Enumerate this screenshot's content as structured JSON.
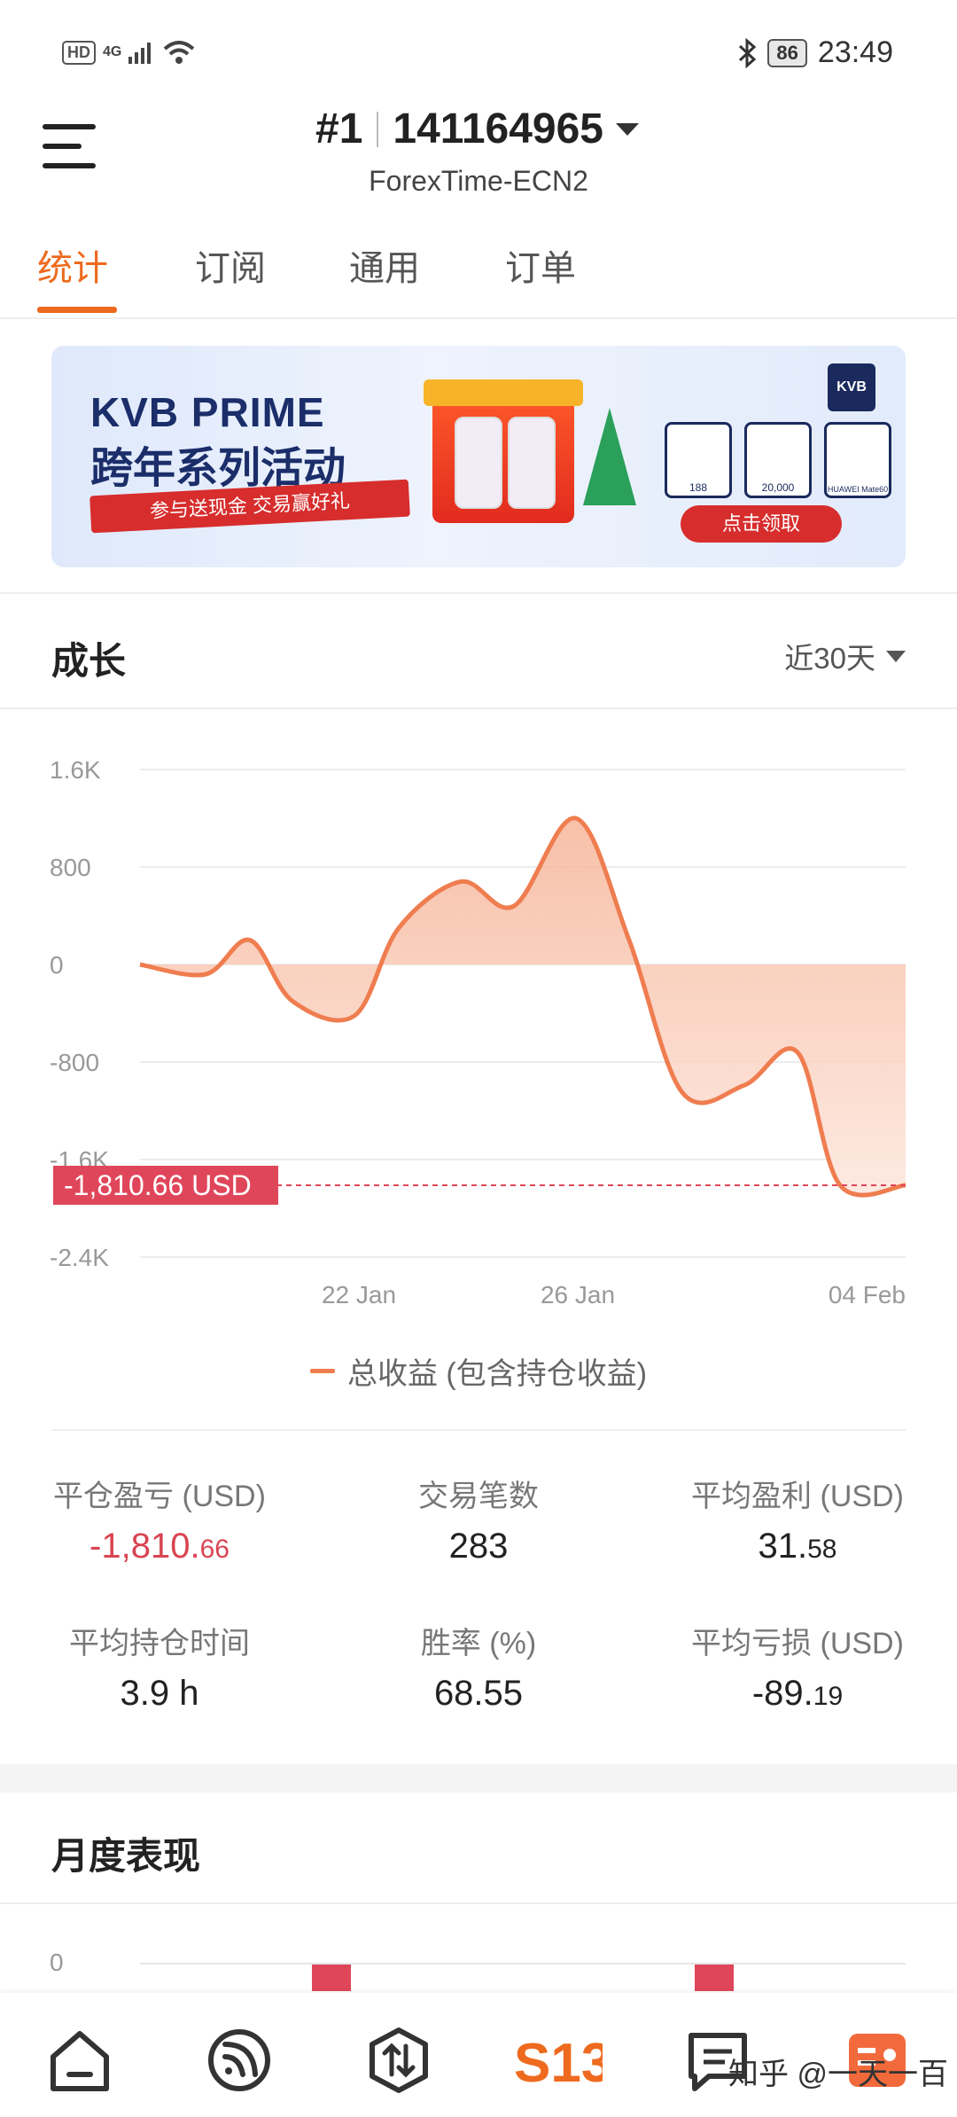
{
  "status_bar": {
    "hd": "HD",
    "network": "4G",
    "battery": "86",
    "time": "23:49"
  },
  "header": {
    "rank": "#1",
    "account": "141164965",
    "server": "ForexTime-ECN2"
  },
  "tabs": [
    "统计",
    "订阅",
    "通用",
    "订单"
  ],
  "banner": {
    "title": "KVB PRIME",
    "subtitle": "跨年系列活动",
    "ribbon": "参与送现金 交易赢好礼",
    "logo": "KVB",
    "prizes": [
      "188",
      "20,000",
      "HUAWEI Mate60"
    ],
    "cta": "点击领取"
  },
  "growth": {
    "title": "成长",
    "period": "近30天"
  },
  "chart_data": {
    "type": "area",
    "yticks": [
      "1.6K",
      "800",
      "0",
      "-800",
      "-1.6K",
      "-2.4K"
    ],
    "ylim": [
      -2400,
      1600
    ],
    "xticks": [
      "22 Jan",
      "26 Jan",
      "04 Feb"
    ],
    "series": [
      {
        "name": "总收益 (包含持仓收益)",
        "color": "#ef7d4f",
        "values": [
          0,
          -80,
          200,
          -300,
          -420,
          300,
          680,
          480,
          1200,
          200,
          -1050,
          -990,
          -720,
          -1810.66,
          -1810.66
        ]
      }
    ],
    "current_label": "-1,810.66 USD",
    "current_value": -1810.66
  },
  "stats": [
    {
      "label": "平仓盈亏 (USD)",
      "main": "-1,810.",
      "dec": "66",
      "red": true
    },
    {
      "label": "交易笔数",
      "main": "283",
      "dec": "",
      "red": false
    },
    {
      "label": "平均盈利 (USD)",
      "main": "31.",
      "dec": "58",
      "red": false
    },
    {
      "label": "平均持仓时间",
      "main": "3.9 h",
      "dec": "",
      "red": false
    },
    {
      "label": "胜率 (%)",
      "main": "68.55",
      "dec": "",
      "red": false
    },
    {
      "label": "平均亏损 (USD)",
      "main": "-89.",
      "dec": "19",
      "red": false
    }
  ],
  "monthly": {
    "title": "月度表现",
    "zero": "0"
  },
  "nav": [
    "home-icon",
    "signal-icon",
    "trade-icon",
    "s13-icon",
    "chat-icon",
    "profile-icon"
  ],
  "watermark": "知乎 @一天一百",
  "colors": {
    "accent": "#ee6a1e",
    "loss": "#d94451",
    "line": "#ef7d4f"
  }
}
